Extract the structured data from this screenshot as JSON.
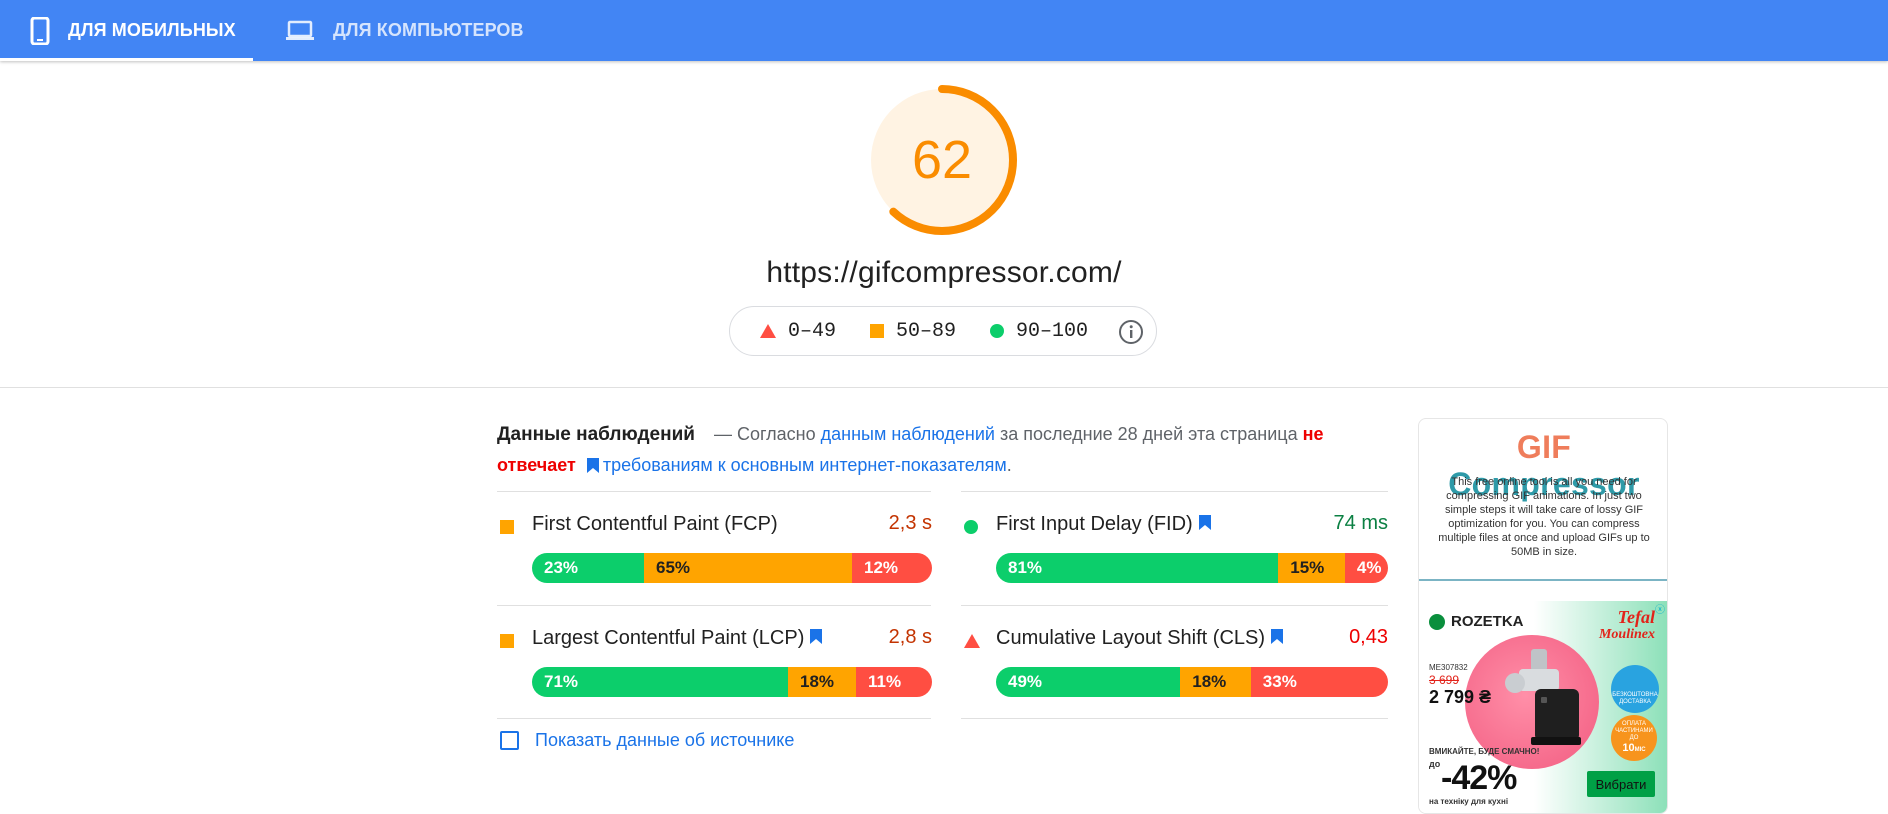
{
  "tabs": [
    {
      "label": "ДЛЯ МОБИЛЬНЫХ",
      "icon": "smartphone-icon",
      "active": true
    },
    {
      "label": "ДЛЯ КОМПЬЮТЕРОВ",
      "icon": "laptop-icon",
      "active": false
    }
  ],
  "score": {
    "value": "62",
    "fraction": 0.62,
    "color": "#fa8c00"
  },
  "url": "https://gifcompressor.com/",
  "legend": {
    "fail": "0–49",
    "average": "50–89",
    "pass": "90–100",
    "info_icon": "info-icon"
  },
  "field_data": {
    "title": "Данные наблюдений",
    "text_1": "— Согласно",
    "link_1": "данным наблюдений",
    "text_2": "за последние 28 дней эта страница",
    "fail_text": "не отвечает",
    "link_2": "требованиям к основным интернет-показателям",
    "text_3": "."
  },
  "metrics": {
    "fcp": {
      "name": "First Contentful Paint (FCP)",
      "value": "2,3 s",
      "good": "23%",
      "avg": "65%",
      "poor": "12%"
    },
    "fid": {
      "name": "First Input Delay (FID)",
      "value": "74 ms",
      "good": "81%",
      "avg": "15%",
      "poor": "4%"
    },
    "lcp": {
      "name": "Largest Contentful Paint (LCP)",
      "value": "2,8 s",
      "good": "71%",
      "avg": "18%",
      "poor": "11%"
    },
    "cls": {
      "name": "Cumulative Layout Shift (CLS)",
      "value": "0,43",
      "good": "49%",
      "avg": "18%",
      "poor": "33%"
    }
  },
  "origin_toggle": "Показать данные об источнике",
  "ad": {
    "title_gif": "GIF",
    "title_rest": "Compressor",
    "desc": "This free online tool is all you need for compressing GIF animations. In just two simple steps it will take care of lossy GIF optimization for you. You can compress multiple files at once and upload GIFs up to 50MB in size.",
    "rozetka": "ROZETKA",
    "tefal": "Tefal",
    "moulinex": "Moulinex",
    "sku": "ME307832",
    "old_price": "3 699",
    "new_price": "2 799 ₴",
    "badge1": "БЕЗКОШТОВНА ДОСТАВКА",
    "badge2_top": "ОПЛАТА ЧАСТИНАМИ ДО",
    "badge2_num": "10",
    "badge2_unit": "МІС",
    "slogan": "ВМИКАЙТЕ, БУДЕ СМАЧНО!",
    "upto": "до",
    "discount": "-42%",
    "tech": "на техніку для кухні",
    "button": "Вибрати",
    "adchoices": "ⓧ"
  }
}
